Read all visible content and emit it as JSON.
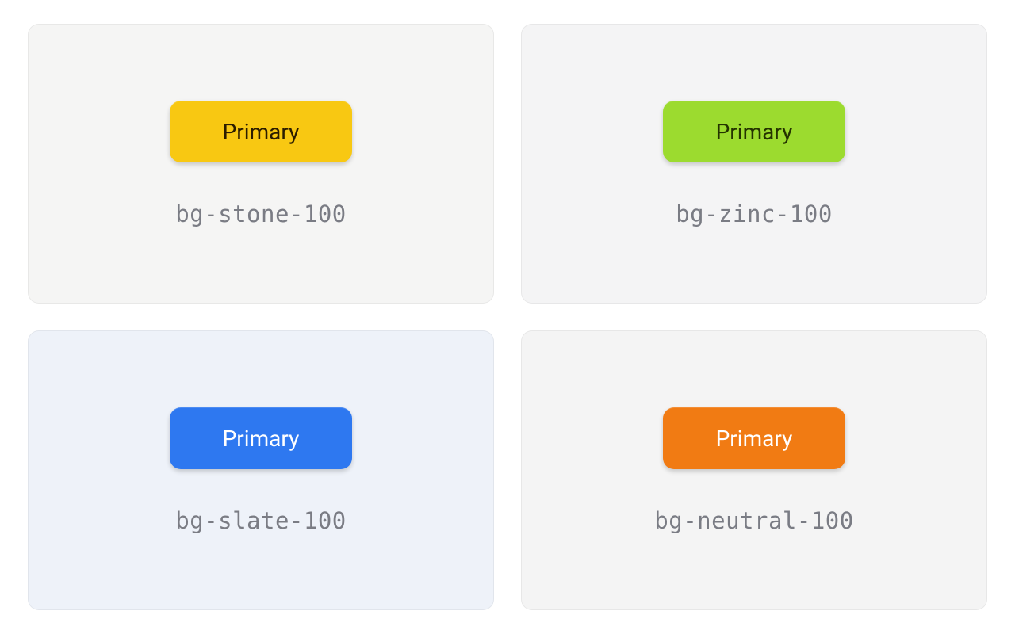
{
  "cards": [
    {
      "button_label": "Primary",
      "caption": "bg-stone-100",
      "bg_class": "bg-stone",
      "btn_class": "btn-yellow"
    },
    {
      "button_label": "Primary",
      "caption": "bg-zinc-100",
      "bg_class": "bg-zinc",
      "btn_class": "btn-lime"
    },
    {
      "button_label": "Primary",
      "caption": "bg-slate-100",
      "bg_class": "bg-slate",
      "btn_class": "btn-blue"
    },
    {
      "button_label": "Primary",
      "caption": "bg-neutral-100",
      "bg_class": "bg-neutral",
      "btn_class": "btn-orange"
    }
  ]
}
